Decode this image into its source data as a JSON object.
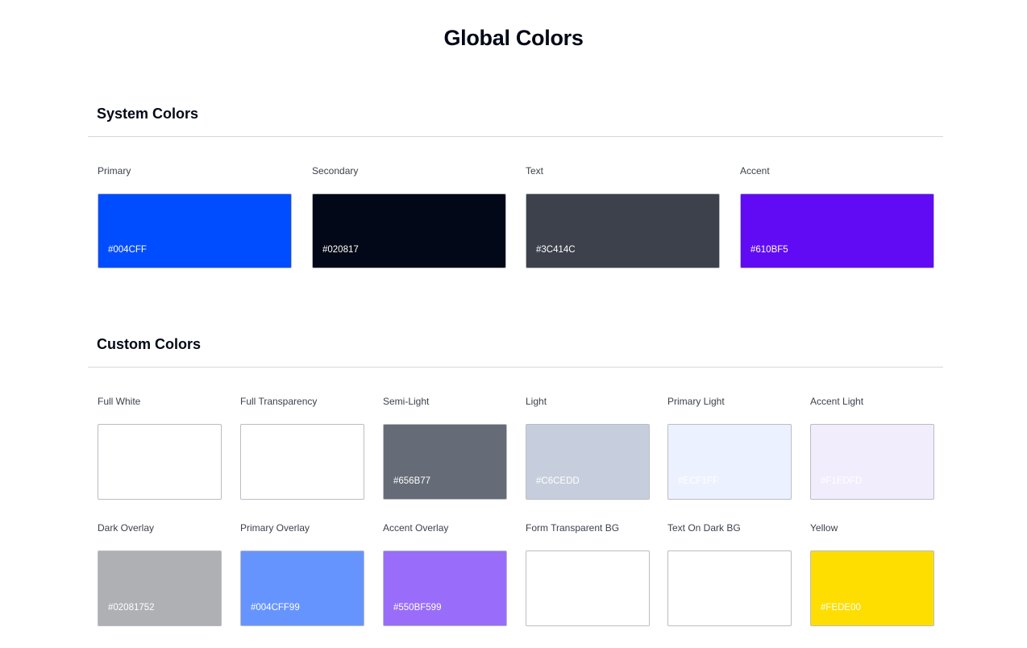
{
  "page": {
    "title": "Global Colors"
  },
  "system": {
    "title": "System Colors",
    "items": [
      {
        "label": "Primary",
        "hex": "#004CFF",
        "color": "#004CFF"
      },
      {
        "label": "Secondary",
        "hex": "#020817",
        "color": "#020817"
      },
      {
        "label": "Text",
        "hex": "#3C414C",
        "color": "#3C414C"
      },
      {
        "label": "Accent",
        "hex": "#610BF5",
        "color": "#610BF5"
      }
    ]
  },
  "custom": {
    "title": "Custom Colors",
    "items": [
      {
        "label": "Full White",
        "hex": "",
        "color": "#FFFFFF"
      },
      {
        "label": "Full Transparency",
        "hex": "",
        "color": "#FFFFFF00"
      },
      {
        "label": "Semi-Light",
        "hex": "#656B77",
        "color": "#656B77"
      },
      {
        "label": "Light",
        "hex": "#C6CEDD",
        "color": "#C6CEDD"
      },
      {
        "label": "Primary Light",
        "hex": "#ECF1FF",
        "color": "#ECF1FF"
      },
      {
        "label": "Accent Light",
        "hex": "#F1EDFD",
        "color": "#F1EDFD"
      },
      {
        "label": "Dark Overlay",
        "hex": "#02081752",
        "color": "#02081752"
      },
      {
        "label": "Primary Overlay",
        "hex": "#004CFF99",
        "color": "#004CFF99"
      },
      {
        "label": "Accent Overlay",
        "hex": "#550BF599",
        "color": "#550BF599"
      },
      {
        "label": "Form Transparent BG",
        "hex": "",
        "color": "#FFFFFF00"
      },
      {
        "label": "Text On Dark BG",
        "hex": "",
        "color": "#FFFFFF"
      },
      {
        "label": "Yellow",
        "hex": "#FEDE00",
        "color": "#FEDE00"
      }
    ]
  }
}
